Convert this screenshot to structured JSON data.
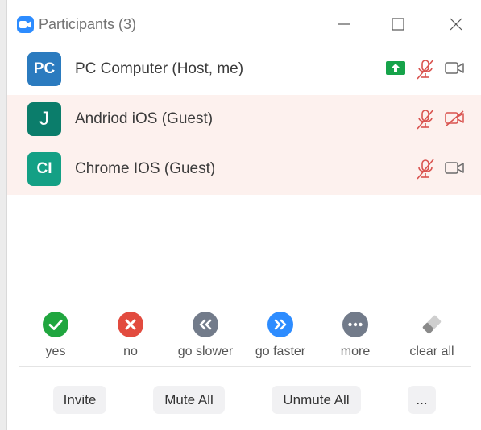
{
  "window": {
    "title": "Participants (3)"
  },
  "participants": [
    {
      "initials": "PC",
      "name": "PC Computer (Host, me)",
      "avatar_color": "#2b7bbf",
      "sharing": true,
      "mic_muted": true,
      "video_on": true,
      "highlighted": false
    },
    {
      "initials": "J",
      "name": "Andriod iOS (Guest)",
      "avatar_color": "#0b7d6b",
      "sharing": false,
      "mic_muted": true,
      "video_on": false,
      "highlighted": true
    },
    {
      "initials": "CI",
      "name": "Chrome IOS (Guest)",
      "avatar_color": "#14a085",
      "sharing": false,
      "mic_muted": true,
      "video_on": true,
      "highlighted": true
    }
  ],
  "reactions": [
    {
      "label": "yes",
      "icon": "checkmark-icon",
      "color": "#20a63f"
    },
    {
      "label": "no",
      "icon": "x-icon",
      "color": "#e24b3f"
    },
    {
      "label": "go slower",
      "icon": "double-chevron-left-icon",
      "color": "#727b8a"
    },
    {
      "label": "go faster",
      "icon": "double-chevron-right-icon",
      "color": "#2d8cff"
    },
    {
      "label": "more",
      "icon": "ellipsis-icon",
      "color": "#727b8a"
    },
    {
      "label": "clear all",
      "icon": "eraser-icon",
      "color": "#8a8a8a"
    }
  ],
  "buttons": {
    "invite": "Invite",
    "mute_all": "Mute All",
    "unmute_all": "Unmute All",
    "more": "..."
  },
  "colors": {
    "accent": "#2d8cff",
    "muted_red": "#d9534f",
    "share_green": "#16a34a",
    "row_highlight": "#fdf1ee"
  }
}
